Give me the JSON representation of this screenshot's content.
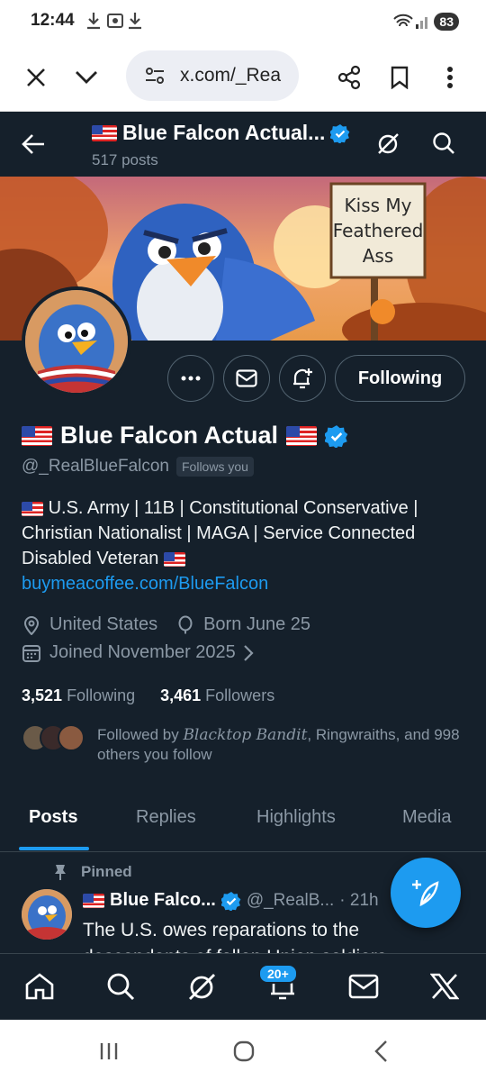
{
  "status_bar": {
    "time": "12:44",
    "battery": "83"
  },
  "browser": {
    "url": "x.com/_Rea",
    "icons": [
      "close-icon",
      "chevron-down-icon",
      "site-settings-icon",
      "share-icon",
      "bookmark-icon",
      "more-vert-icon"
    ]
  },
  "header": {
    "title": "Blue Falcon Actual...",
    "post_count": "517 posts"
  },
  "banner": {
    "sign_text": [
      "Kiss My",
      "Feathered",
      "Ass"
    ]
  },
  "profile": {
    "name": "Blue Falcon Actual",
    "handle": "@_RealBlueFalcon",
    "follows_you": "Follows you",
    "bio_line1": "U.S. Army | 11B | Constitutional Conservative | Christian Nationalist | MAGA | Service Connected Disabled Veteran",
    "bio_link": "buymeacoffee.com/BlueFalcon",
    "location": "United States",
    "birthday": "Born June 25",
    "joined": "Joined November 2025",
    "following_count": "3,521",
    "following_label": "Following",
    "followers_count": "3,461",
    "followers_label": "Followers",
    "followed_by_prefix": "Followed by ",
    "followed_by_name": "Blacktop Bandit",
    "followed_by_suffix": ", Ringwraiths, and 998 others you follow"
  },
  "actions": {
    "following_label": "Following"
  },
  "tabs": [
    {
      "label": "Posts",
      "active": true
    },
    {
      "label": "Replies",
      "active": false
    },
    {
      "label": "Highlights",
      "active": false
    },
    {
      "label": "Media",
      "active": false
    }
  ],
  "pinned_post": {
    "pinned_label": "Pinned",
    "author": "Blue Falco...",
    "handle": "@_RealB...",
    "time": "· 21h",
    "text": "The U.S. owes reparations to the descendants of fallen Union soldiers"
  },
  "bottom_nav": {
    "notifications_badge": "20+"
  },
  "colors": {
    "background": "#15202b",
    "accent": "#1d9bf0",
    "muted": "#8b98a5",
    "border": "#38444d"
  }
}
